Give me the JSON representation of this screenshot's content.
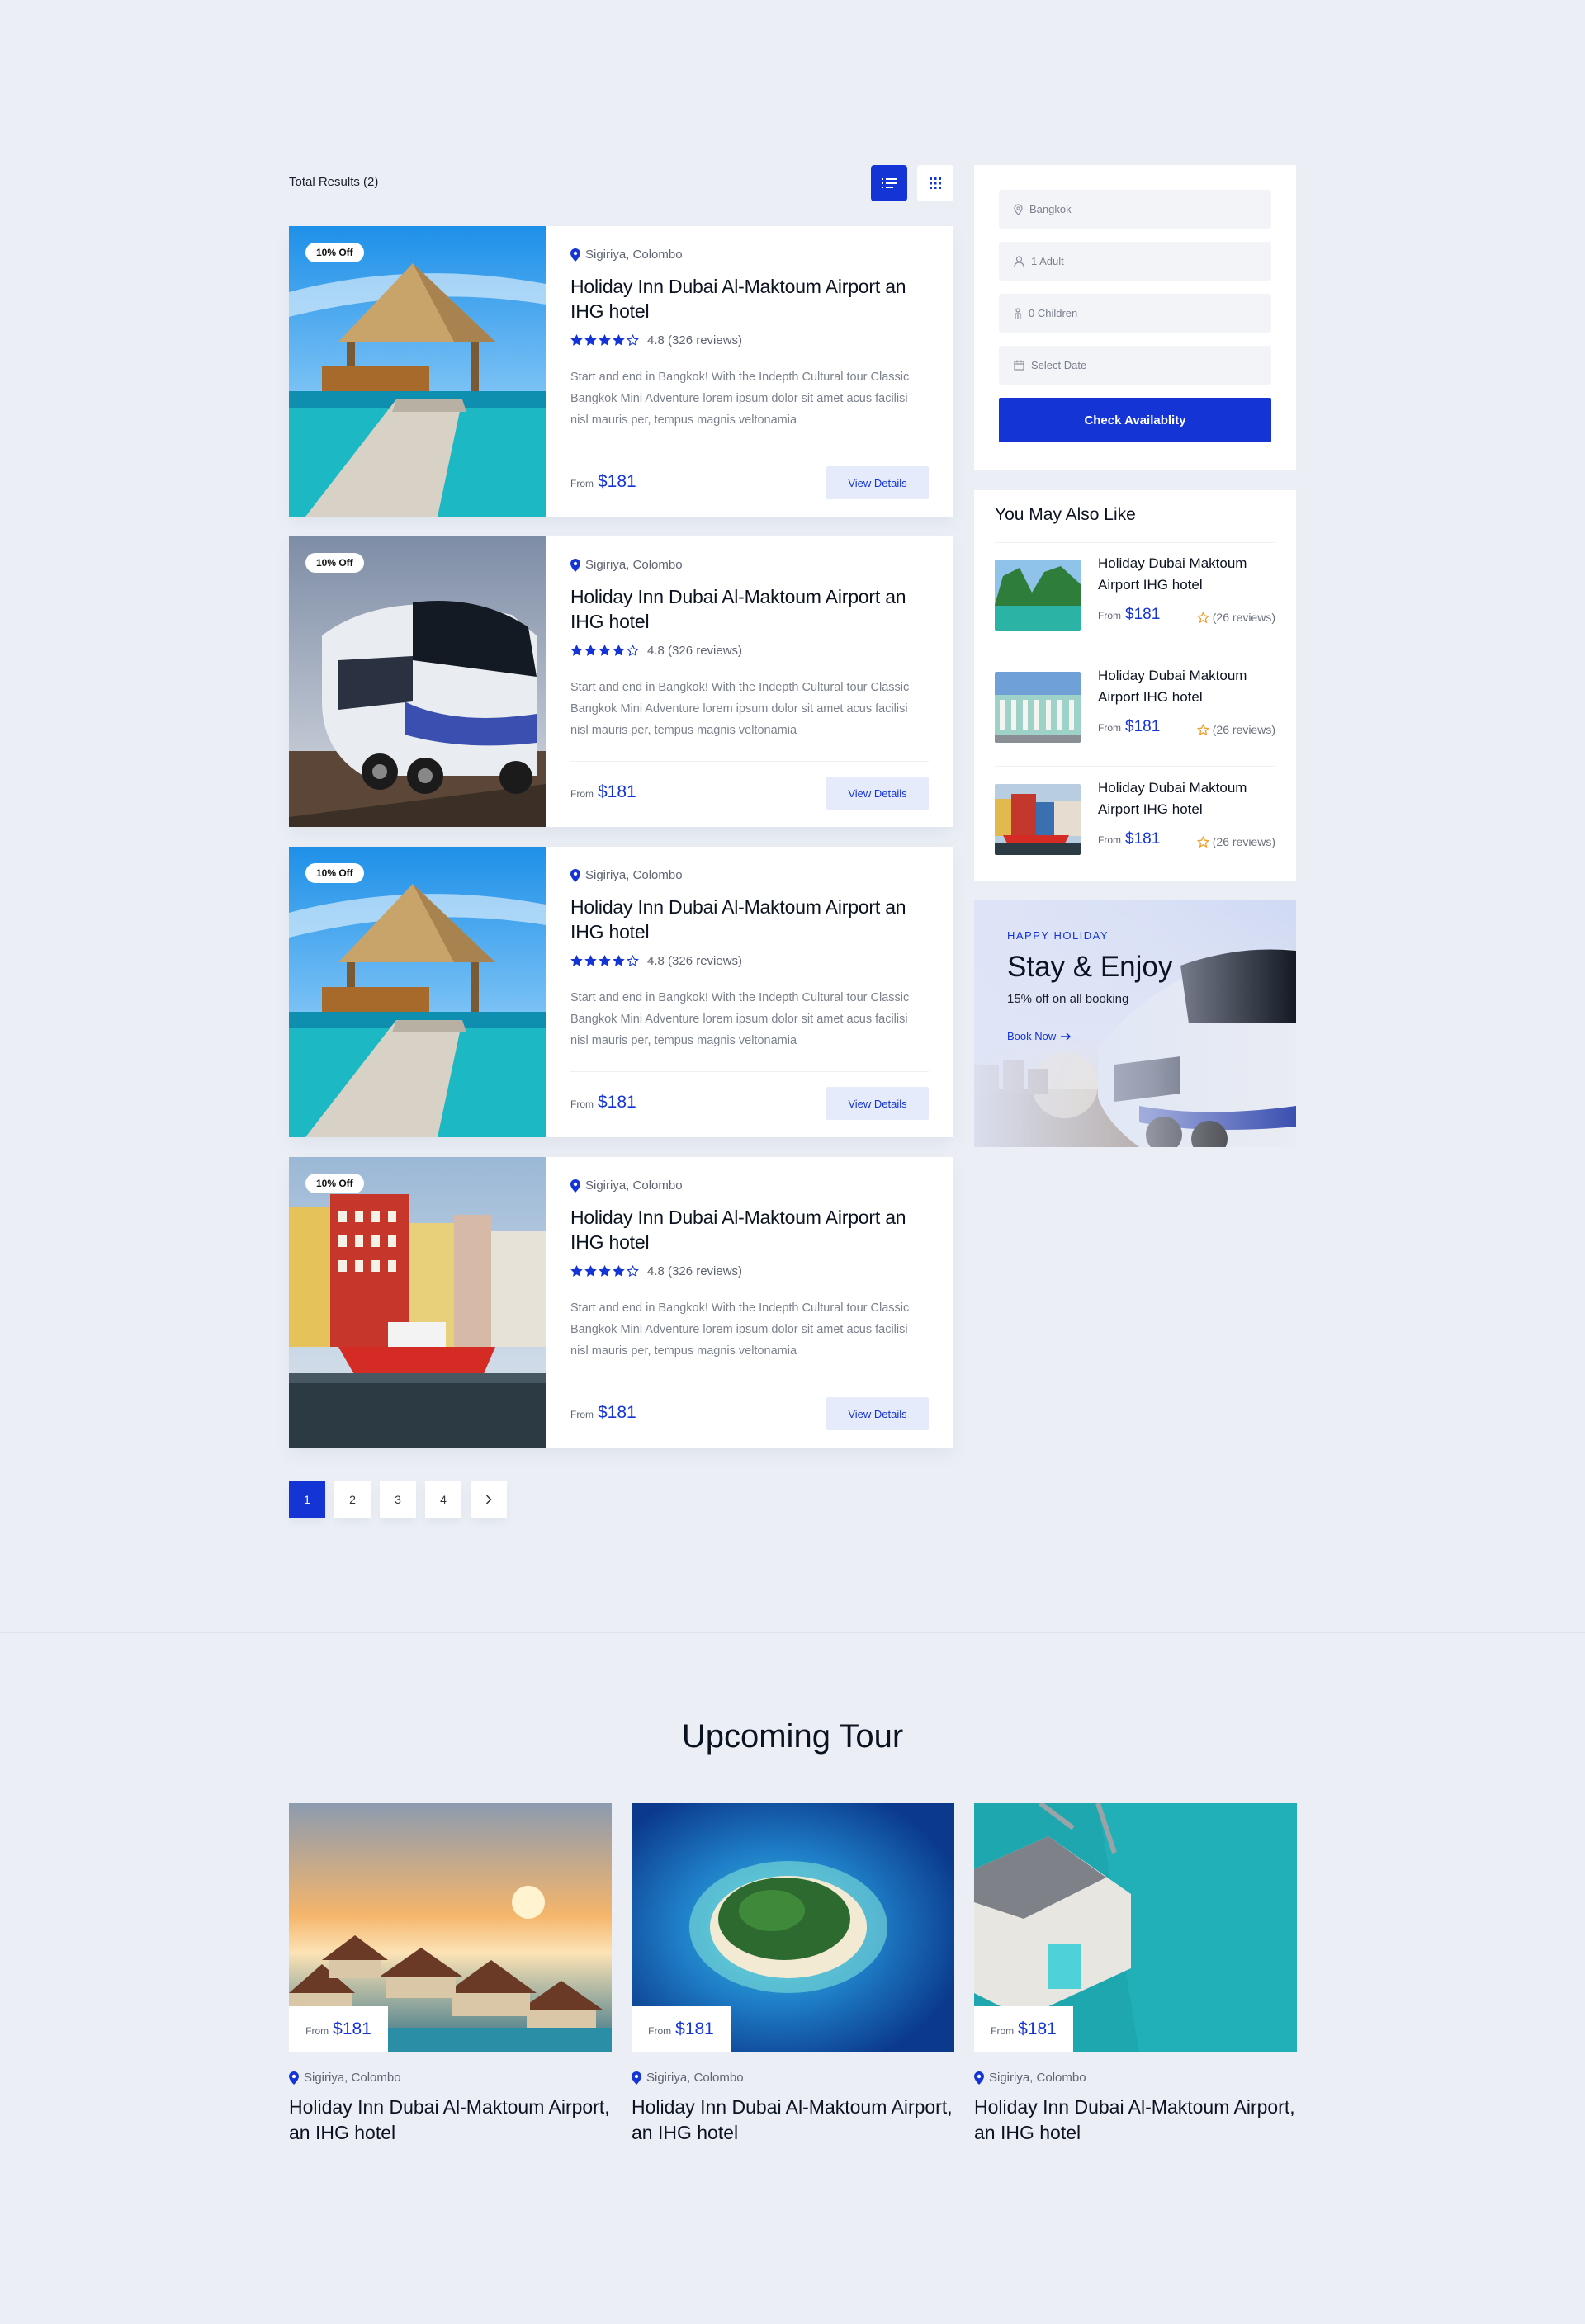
{
  "results": {
    "total_label": "Total Results (2)"
  },
  "listings": [
    {
      "badge": "10% Off",
      "location": "Sigiriya, Colombo",
      "title": "Holiday Inn Dubai Al-Maktoum Airport an IHG hotel",
      "rating_text": "4.8 (326 reviews)",
      "stars": 4,
      "description": "Start and end in Bangkok! With the Indepth Cultural tour Classic Bangkok Mini Adventure lorem ipsum dolor sit amet acus facilisi nisl mauris per, tempus magnis veltonamia",
      "price_from": "From",
      "price": "$181",
      "button": "View Details",
      "image": "beach-gazebo"
    },
    {
      "badge": "10% Off",
      "location": "Sigiriya, Colombo",
      "title": "Holiday Inn Dubai Al-Maktoum Airport an IHG hotel",
      "rating_text": "4.8 (326 reviews)",
      "stars": 4,
      "description": "Start and end in Bangkok! With the Indepth Cultural tour Classic Bangkok Mini Adventure lorem ipsum dolor sit amet acus facilisi nisl mauris per, tempus magnis veltonamia",
      "price_from": "From",
      "price": "$181",
      "button": "View Details",
      "image": "tour-bus"
    },
    {
      "badge": "10% Off",
      "location": "Sigiriya, Colombo",
      "title": "Holiday Inn Dubai Al-Maktoum Airport an IHG hotel",
      "rating_text": "4.8 (326 reviews)",
      "stars": 4,
      "description": "Start and end in Bangkok! With the Indepth Cultural tour Classic Bangkok Mini Adventure lorem ipsum dolor sit amet acus facilisi nisl mauris per, tempus magnis veltonamia",
      "price_from": "From",
      "price": "$181",
      "button": "View Details",
      "image": "beach-gazebo"
    },
    {
      "badge": "10% Off",
      "location": "Sigiriya, Colombo",
      "title": "Holiday Inn Dubai Al-Maktoum Airport an IHG hotel",
      "rating_text": "4.8 (326 reviews)",
      "stars": 4,
      "description": "Start and end in Bangkok! With the Indepth Cultural tour Classic Bangkok Mini Adventure lorem ipsum dolor sit amet acus facilisi nisl mauris per, tempus magnis veltonamia",
      "price_from": "From",
      "price": "$181",
      "button": "View Details",
      "image": "harbor-houses"
    }
  ],
  "pagination": {
    "pages": [
      "1",
      "2",
      "3",
      "4"
    ],
    "current": "1",
    "next_icon": "chevron-right-icon"
  },
  "search": {
    "location": "Bangkok",
    "adults": "1 Adult",
    "children": "0 Children",
    "date": "Select Date",
    "button": "Check Availablity"
  },
  "also_like": {
    "title": "You May Also Like",
    "items": [
      {
        "title": "Holiday Dubai Maktoum Airport IHG hotel",
        "price_from": "From",
        "price": "$181",
        "reviews": "(26 reviews)",
        "image": "lagoon-cliffs"
      },
      {
        "title": "Holiday Dubai Maktoum Airport IHG hotel",
        "price_from": "From",
        "price": "$181",
        "reviews": "(26 reviews)",
        "image": "palace-building"
      },
      {
        "title": "Holiday Dubai Maktoum Airport IHG hotel",
        "price_from": "From",
        "price": "$181",
        "reviews": "(26 reviews)",
        "image": "harbor-houses"
      }
    ]
  },
  "promo": {
    "eyebrow": "HAPPY HOLIDAY",
    "title": "Stay & Enjoy",
    "subtitle": "15% off on all booking",
    "link": "Book Now",
    "link_icon": "arrow-right-icon"
  },
  "upcoming": {
    "title": "Upcoming Tour",
    "tours": [
      {
        "price_from": "From",
        "price": "$181",
        "location": "Sigiriya, Colombo",
        "title": "Holiday Inn Dubai Al-Maktoum Airport, an IHG hotel",
        "image": "sunset-villas"
      },
      {
        "price_from": "From",
        "price": "$181",
        "location": "Sigiriya, Colombo",
        "title": "Holiday Inn Dubai Al-Maktoum Airport, an IHG hotel",
        "image": "island-aerial"
      },
      {
        "price_from": "From",
        "price": "$181",
        "location": "Sigiriya, Colombo",
        "title": "Holiday Inn Dubai Al-Maktoum Airport, an IHG hotel",
        "image": "overwater-villa"
      }
    ]
  },
  "colors": {
    "primary": "#1434d6",
    "background": "#ebeff5",
    "star_orange": "#f29d2b"
  }
}
